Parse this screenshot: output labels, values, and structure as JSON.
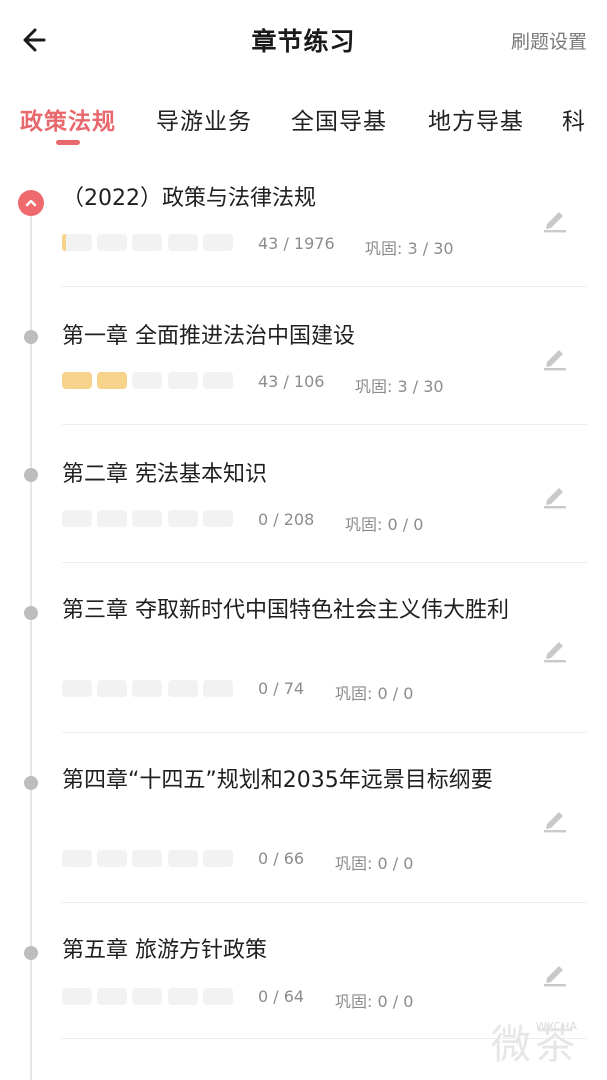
{
  "header": {
    "title": "章节练习",
    "settings_label": "刷题设置"
  },
  "tabs": [
    {
      "label": "政策法规",
      "active": true
    },
    {
      "label": "导游业务",
      "active": false
    },
    {
      "label": "全国导基",
      "active": false
    },
    {
      "label": "地方导基",
      "active": false
    },
    {
      "label": "科",
      "active": false
    }
  ],
  "chapters": [
    {
      "title": "（2022）政策与法律法规",
      "done": 43,
      "total": 1976,
      "count": "43 / 1976",
      "review": "巩固: 3 / 30",
      "active": true,
      "segments": [
        "partial",
        "empty",
        "empty",
        "empty",
        "empty"
      ]
    },
    {
      "title": "第一章 全面推进法治中国建设",
      "done": 43,
      "total": 106,
      "count": "43 / 106",
      "review": "巩固: 3 / 30",
      "active": false,
      "segments": [
        "filled",
        "filled",
        "empty",
        "empty",
        "empty"
      ]
    },
    {
      "title": "第二章 宪法基本知识",
      "done": 0,
      "total": 208,
      "count": "0 / 208",
      "review": "巩固: 0 / 0",
      "active": false,
      "segments": [
        "empty",
        "empty",
        "empty",
        "empty",
        "empty"
      ]
    },
    {
      "title": "第三章 夺取新时代中国特色社会主义伟大胜利",
      "done": 0,
      "total": 74,
      "count": "0 / 74",
      "review": "巩固: 0 / 0",
      "active": false,
      "segments": [
        "empty",
        "empty",
        "empty",
        "empty",
        "empty"
      ]
    },
    {
      "title": "第四章“十四五”规划和2035年远景目标纲要",
      "done": 0,
      "total": 66,
      "count": "0 / 66",
      "review": "巩固: 0 / 0",
      "active": false,
      "segments": [
        "empty",
        "empty",
        "empty",
        "empty",
        "empty"
      ]
    },
    {
      "title": "第五章  旅游方针政策",
      "done": 0,
      "total": 64,
      "count": "0 / 64",
      "review": "巩固: 0 / 0",
      "active": false,
      "segments": [
        "empty",
        "empty",
        "empty",
        "empty",
        "empty"
      ]
    }
  ],
  "watermark": {
    "text": "微茶",
    "sub": "WXCHA"
  },
  "colors": {
    "accent": "#e8696d",
    "progress": "#f7d28a",
    "track": "#f2f2f2"
  },
  "icons": {
    "back": "arrow-left-icon",
    "edit": "pencil-icon",
    "collapse": "chevron-up-icon"
  }
}
